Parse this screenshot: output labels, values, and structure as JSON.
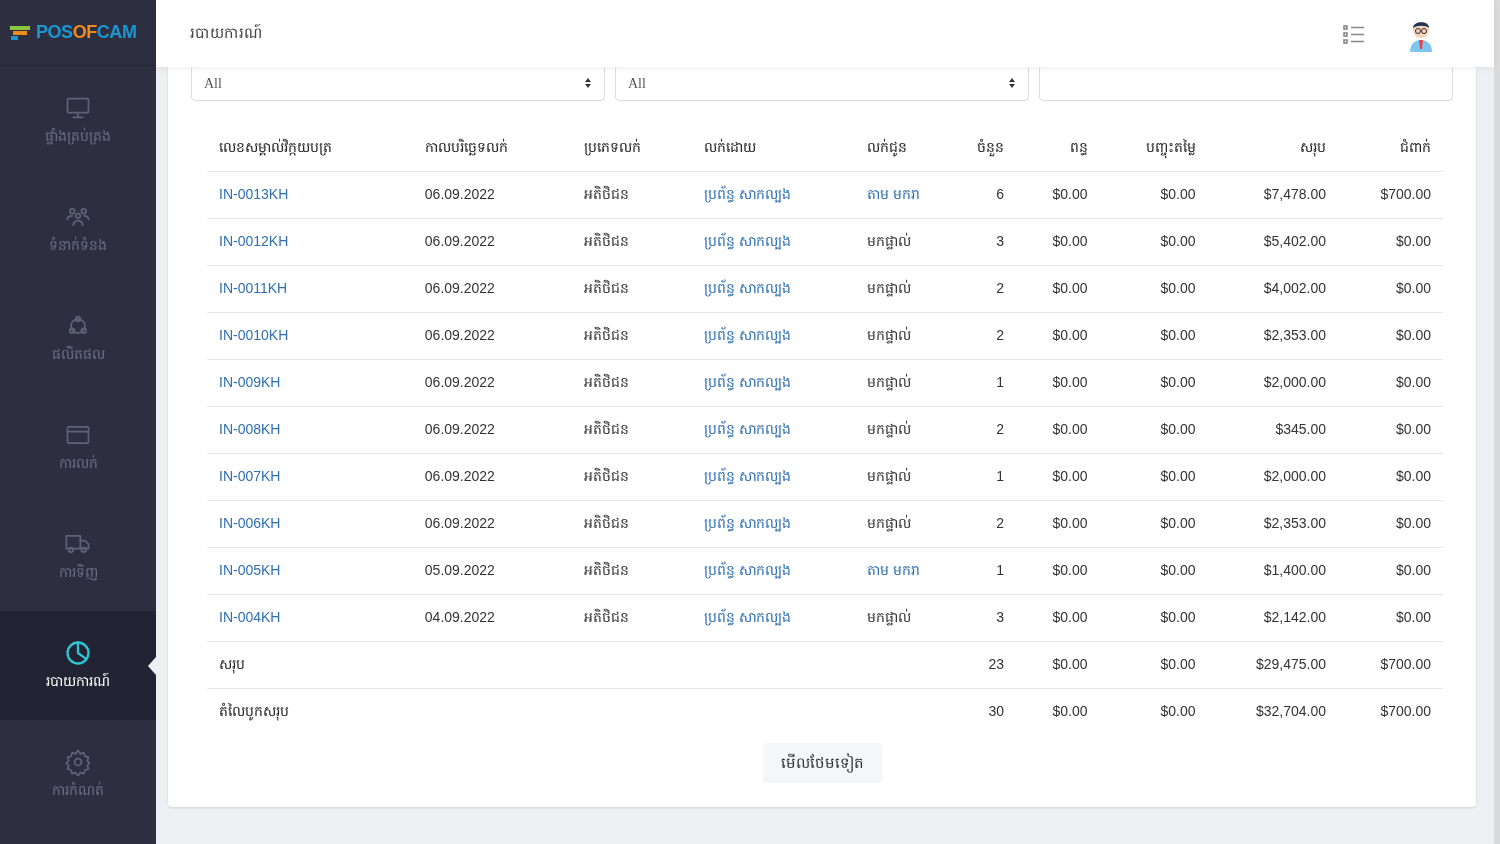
{
  "logo": [
    {
      "text": "POS",
      "color": "#1b96d3"
    },
    {
      "text": "OF",
      "color": "#f08a1d"
    },
    {
      "text": "CAM",
      "color": "#1b96d3"
    }
  ],
  "sidebar": {
    "items": [
      {
        "label": "ផ្ទាំងគ្រប់គ្រង",
        "kind": "monitor",
        "selected": false
      },
      {
        "label": "ទំនាក់ទំនង",
        "kind": "people",
        "selected": false
      },
      {
        "label": "ផលិតផល",
        "kind": "product",
        "selected": false
      },
      {
        "label": "ការលក់",
        "kind": "card",
        "selected": false
      },
      {
        "label": "ការទិញ",
        "kind": "truck",
        "selected": false
      },
      {
        "label": "របាយការណ៍",
        "kind": "chart",
        "selected": true
      },
      {
        "label": "ការកំណត់",
        "kind": "gear",
        "selected": false
      }
    ]
  },
  "header": {
    "title": "របាយការណ៍"
  },
  "filters": [
    {
      "kind": "select",
      "value": "All"
    },
    {
      "kind": "select",
      "value": "All"
    },
    {
      "kind": "input"
    }
  ],
  "table": {
    "columns": [
      "លេខសម្គាល់វិក្កយបត្រ",
      "កាលបរិច្ឆេទលក់",
      "ប្រភេទលក់",
      "លក់ដោយ",
      "លក់ជូន",
      "ចំនួន",
      "ពន្ធ",
      "បញ្ចុះតម្លៃ",
      "សរុប",
      "ជំពាក់"
    ],
    "rows": [
      {
        "invoice": "IN-0013KH",
        "date": "06.09.2022",
        "type": "អតិថិជន",
        "seller": "ប្រព័ន្ធ សាកល្បង",
        "customer": "តាម មករា",
        "customer_link": true,
        "qty": "6",
        "tax": "$0.00",
        "discount": "$0.00",
        "total": "$7,478.00",
        "due": "$700.00"
      },
      {
        "invoice": "IN-0012KH",
        "date": "06.09.2022",
        "type": "អតិថិជន",
        "seller": "ប្រព័ន្ធ សាកល្បង",
        "customer": "មកផ្ទាល់",
        "customer_link": false,
        "qty": "3",
        "tax": "$0.00",
        "discount": "$0.00",
        "total": "$5,402.00",
        "due": "$0.00"
      },
      {
        "invoice": "IN-0011KH",
        "date": "06.09.2022",
        "type": "អតិថិជន",
        "seller": "ប្រព័ន្ធ សាកល្បង",
        "customer": "មកផ្ទាល់",
        "customer_link": false,
        "qty": "2",
        "tax": "$0.00",
        "discount": "$0.00",
        "total": "$4,002.00",
        "due": "$0.00"
      },
      {
        "invoice": "IN-0010KH",
        "date": "06.09.2022",
        "type": "អតិថិជន",
        "seller": "ប្រព័ន្ធ សាកល្បង",
        "customer": "មកផ្ទាល់",
        "customer_link": false,
        "qty": "2",
        "tax": "$0.00",
        "discount": "$0.00",
        "total": "$2,353.00",
        "due": "$0.00"
      },
      {
        "invoice": "IN-009KH",
        "date": "06.09.2022",
        "type": "អតិថិជន",
        "seller": "ប្រព័ន្ធ សាកល្បង",
        "customer": "មកផ្ទាល់",
        "customer_link": false,
        "qty": "1",
        "tax": "$0.00",
        "discount": "$0.00",
        "total": "$2,000.00",
        "due": "$0.00"
      },
      {
        "invoice": "IN-008KH",
        "date": "06.09.2022",
        "type": "អតិថិជន",
        "seller": "ប្រព័ន្ធ សាកល្បង",
        "customer": "មកផ្ទាល់",
        "customer_link": false,
        "qty": "2",
        "tax": "$0.00",
        "discount": "$0.00",
        "total": "$345.00",
        "due": "$0.00"
      },
      {
        "invoice": "IN-007KH",
        "date": "06.09.2022",
        "type": "អតិថិជន",
        "seller": "ប្រព័ន្ធ សាកល្បង",
        "customer": "មកផ្ទាល់",
        "customer_link": false,
        "qty": "1",
        "tax": "$0.00",
        "discount": "$0.00",
        "total": "$2,000.00",
        "due": "$0.00"
      },
      {
        "invoice": "IN-006KH",
        "date": "06.09.2022",
        "type": "អតិថិជន",
        "seller": "ប្រព័ន្ធ សាកល្បង",
        "customer": "មកផ្ទាល់",
        "customer_link": false,
        "qty": "2",
        "tax": "$0.00",
        "discount": "$0.00",
        "total": "$2,353.00",
        "due": "$0.00"
      },
      {
        "invoice": "IN-005KH",
        "date": "05.09.2022",
        "type": "អតិថិជន",
        "seller": "ប្រព័ន្ធ សាកល្បង",
        "customer": "តាម មករា",
        "customer_link": true,
        "qty": "1",
        "tax": "$0.00",
        "discount": "$0.00",
        "total": "$1,400.00",
        "due": "$0.00"
      },
      {
        "invoice": "IN-004KH",
        "date": "04.09.2022",
        "type": "អតិថិជន",
        "seller": "ប្រព័ន្ធ សាកល្បង",
        "customer": "មកផ្ទាល់",
        "customer_link": false,
        "qty": "3",
        "tax": "$0.00",
        "discount": "$0.00",
        "total": "$2,142.00",
        "due": "$0.00"
      }
    ],
    "totals": [
      {
        "label": "សរុប",
        "qty": "23",
        "tax": "$0.00",
        "discount": "$0.00",
        "total": "$29,475.00",
        "due": "$700.00"
      },
      {
        "label": "តំលៃបូកសរុប",
        "qty": "30",
        "tax": "$0.00",
        "discount": "$0.00",
        "total": "$32,704.00",
        "due": "$700.00"
      }
    ]
  },
  "load_more": "មើលថែមទៀត"
}
